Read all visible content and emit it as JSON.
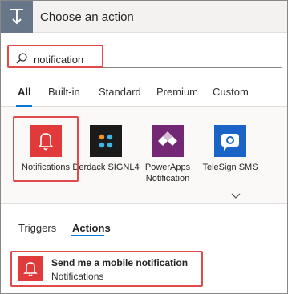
{
  "header": {
    "title": "Choose an action",
    "icon": "action-arrow-icon"
  },
  "search": {
    "value": "notification",
    "icon": "search-icon"
  },
  "tabs": [
    {
      "label": "All",
      "active": true
    },
    {
      "label": "Built-in",
      "active": false
    },
    {
      "label": "Standard",
      "active": false
    },
    {
      "label": "Premium",
      "active": false
    },
    {
      "label": "Custom",
      "active": false
    }
  ],
  "connectors": [
    {
      "label": "Notifications",
      "color": "#e03a3a",
      "icon": "bell-icon",
      "selected": true
    },
    {
      "label": "Derdack SIGNL4",
      "color": "#1b1b1b",
      "icon": "signl4-dots-icon",
      "selected": false
    },
    {
      "label": "PowerApps Notification",
      "color": "#742774",
      "icon": "powerapps-icon",
      "selected": false
    },
    {
      "label": "TeleSign SMS",
      "color": "#1a64c8",
      "icon": "telesign-icon",
      "selected": false
    }
  ],
  "section_tabs": [
    {
      "label": "Triggers",
      "active": false
    },
    {
      "label": "Actions",
      "active": true
    }
  ],
  "actions": [
    {
      "title": "Send me a mobile notification",
      "connector": "Notifications",
      "color": "#e03a3a",
      "icon": "bell-icon"
    }
  ],
  "colors": {
    "accent": "#0078d4",
    "highlight": "#e04a4a",
    "header_icon_bg": "#68768a"
  }
}
